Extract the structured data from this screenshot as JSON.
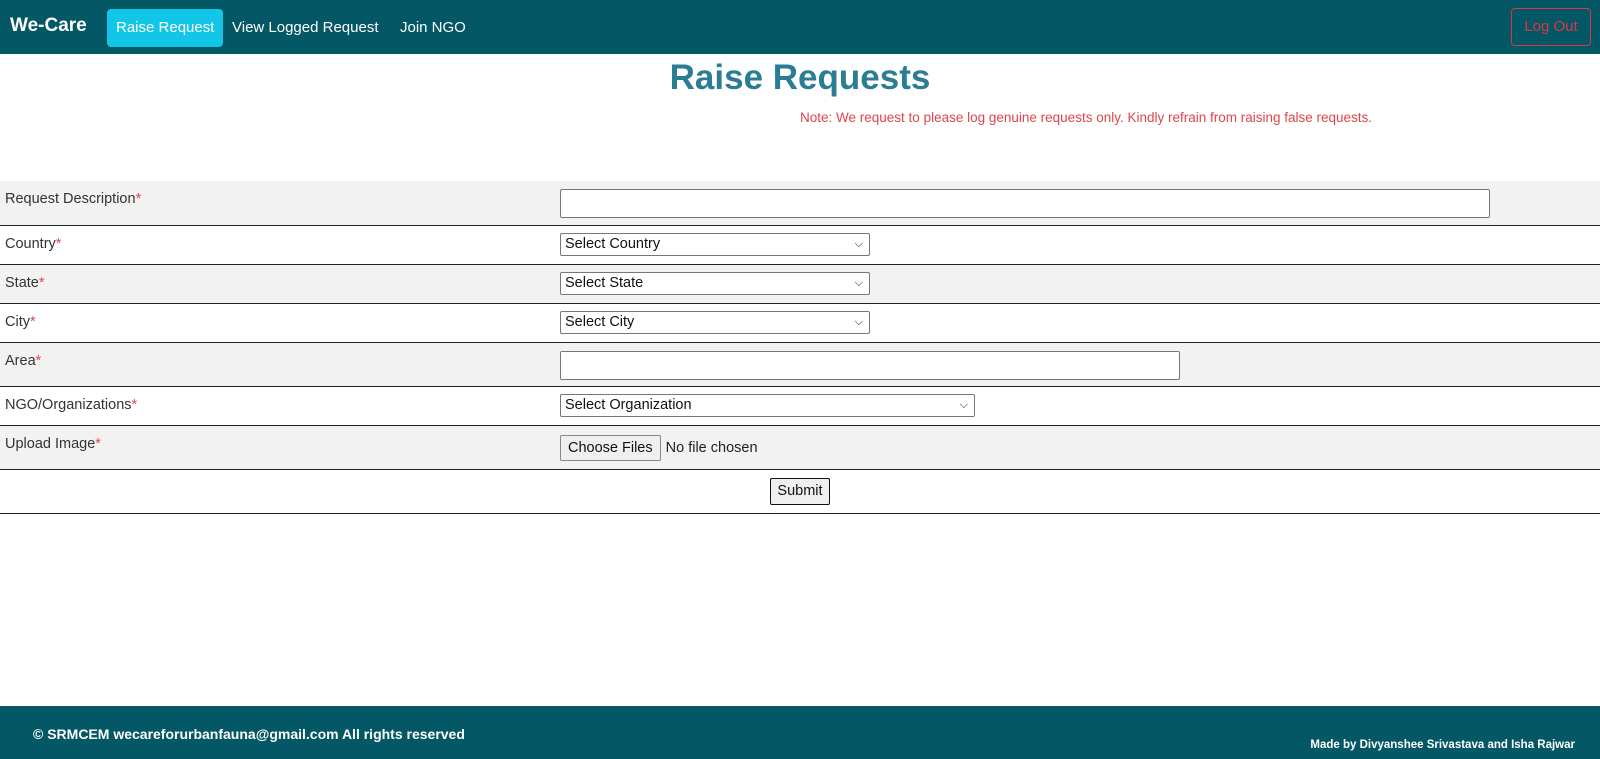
{
  "navbar": {
    "brand": "We-Care",
    "links": [
      {
        "label": "Raise Request",
        "active": true
      },
      {
        "label": "View Logged Request",
        "active": false
      },
      {
        "label": "Join NGO",
        "active": false
      }
    ],
    "logout_label": "Log Out"
  },
  "page": {
    "title": "Raise Requests",
    "note": "Note: We request to please log genuine requests only. Kindly refrain from raising false requests."
  },
  "form": {
    "required_mark": "*",
    "request_description": {
      "label": "Request Description",
      "value": ""
    },
    "country": {
      "label": "Country",
      "selected": "Select Country"
    },
    "state": {
      "label": "State",
      "selected": "Select State"
    },
    "city": {
      "label": "City",
      "selected": "Select City"
    },
    "area": {
      "label": "Area",
      "value": ""
    },
    "organization": {
      "label": "NGO/Organizations",
      "selected": "Select Organization"
    },
    "upload": {
      "label": "Upload Image",
      "button_label": "Choose Files",
      "status": "No file chosen"
    },
    "submit_label": "Submit"
  },
  "footer": {
    "left_text": "© SRMCEM wecareforurbanfauna@gmail.com All rights reserved",
    "right_text": "Made by Divyanshee Srivastava and Isha Rajwar"
  },
  "colors": {
    "navbar_bg": "#045764",
    "active_tab": "#12c6e8",
    "title": "#2a7d92",
    "danger": "#dc3545",
    "note": "#e0454b"
  }
}
